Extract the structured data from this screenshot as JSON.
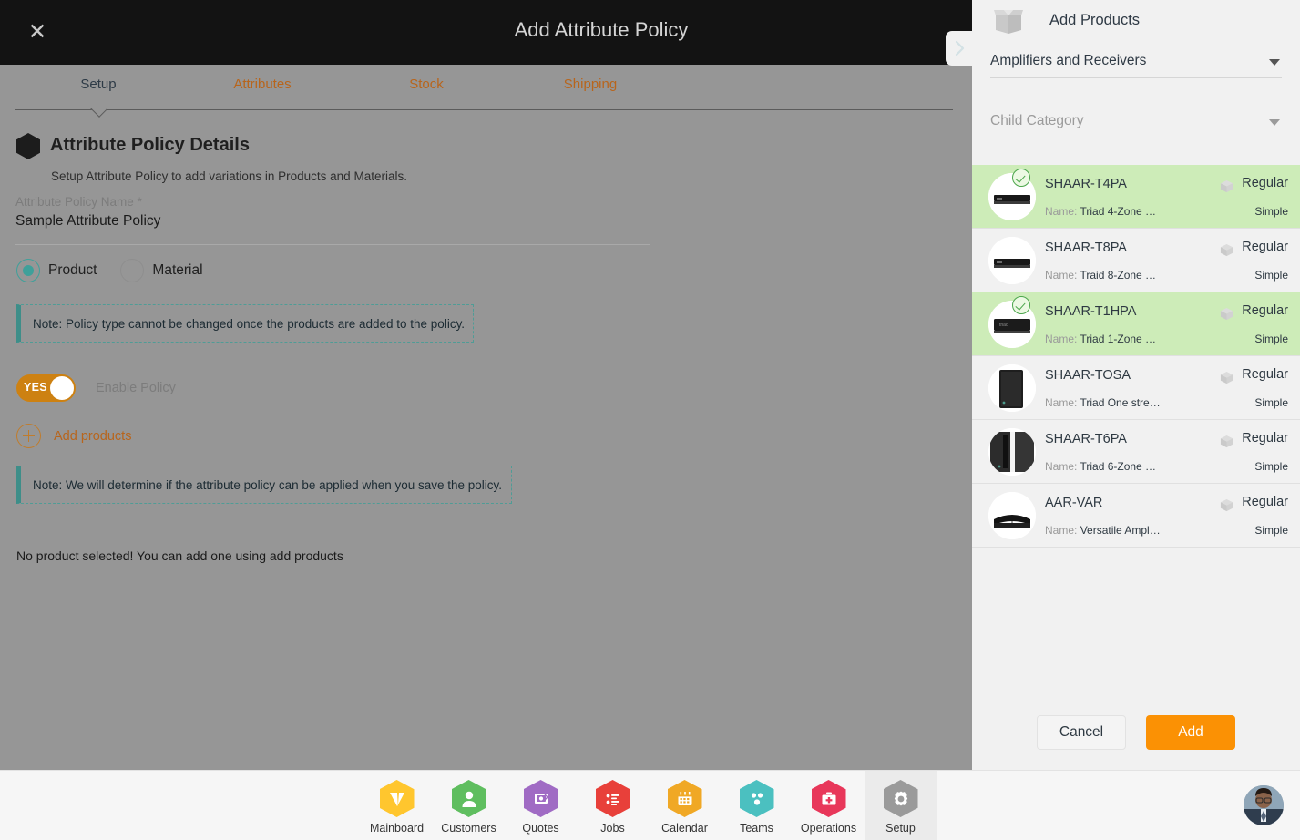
{
  "topbar": {
    "close_icon": "close-icon",
    "title": "Add Attribute Policy",
    "drawer_icon": "chevron-right-icon"
  },
  "tabs": [
    {
      "label": "Setup",
      "active": true
    },
    {
      "label": "Attributes",
      "active": false
    },
    {
      "label": "Stock",
      "active": false
    },
    {
      "label": "Shipping",
      "active": false
    }
  ],
  "form": {
    "section_icon": "hexagon-icon",
    "section_title": "Attribute Policy Details",
    "section_subtitle": "Setup Attribute Policy to add variations in Products and Materials.",
    "policy_name_label": "Attribute Policy Name *",
    "policy_name_value": "Sample Attribute Policy",
    "radio_product": "Product",
    "radio_material": "Material",
    "selected_type": "Product",
    "note_1": "Note: Policy type cannot be changed once the products are added to the policy.",
    "toggle_state": "YES",
    "toggle_label": "Enable Policy",
    "add_products_label": "Add products",
    "note_2": "Note: We will determine if the attribute policy can be applied when you save the policy.",
    "empty_message": "No product selected! You can add one using add products"
  },
  "panel": {
    "icon": "box-icon",
    "title": "Add Products",
    "parent_category_value": "Amplifiers and Receivers",
    "child_category_placeholder": "Child Category",
    "dropdown_icon": "chevron-down-icon",
    "name_key": "Name:",
    "cancel_label": "Cancel",
    "add_label": "Add",
    "products": [
      {
        "sku": "SHAAR-T4PA",
        "name": "Triad 4-Zone …",
        "type": "Regular",
        "variant": "Simple",
        "selected": true,
        "thumb": "amp-flat-black"
      },
      {
        "sku": "SHAAR-T8PA",
        "name": "Traid 8-Zone …",
        "type": "Regular",
        "variant": "Simple",
        "selected": false,
        "thumb": "amp-flat-black"
      },
      {
        "sku": "SHAAR-T1HPA",
        "name": "Triad 1-Zone …",
        "type": "Regular",
        "variant": "Simple",
        "selected": true,
        "thumb": "amp-box-black"
      },
      {
        "sku": "SHAAR-TOSA",
        "name": "Triad One stre…",
        "type": "Regular",
        "variant": "Simple",
        "selected": false,
        "thumb": "tower-black"
      },
      {
        "sku": "SHAAR-T6PA",
        "name": "Triad 6-Zone …",
        "type": "Regular",
        "variant": "Simple",
        "selected": false,
        "thumb": "rack-black"
      },
      {
        "sku": "AAR-VAR",
        "name": "Versatile Ampl…",
        "type": "Regular",
        "variant": "Simple",
        "selected": false,
        "thumb": "slab-black"
      }
    ]
  },
  "bottomnav": {
    "items": [
      {
        "label": "Mainboard",
        "icon": "mainboard-icon",
        "color": "#FFC62E",
        "active": false
      },
      {
        "label": "Customers",
        "icon": "customers-icon",
        "color": "#5FBE5F",
        "active": false
      },
      {
        "label": "Quotes",
        "icon": "quotes-icon",
        "color": "#A06BC4",
        "active": false
      },
      {
        "label": "Jobs",
        "icon": "jobs-icon",
        "color": "#E8403A",
        "active": false
      },
      {
        "label": "Calendar",
        "icon": "calendar-icon",
        "color": "#F0A825",
        "active": false
      },
      {
        "label": "Teams",
        "icon": "teams-icon",
        "color": "#4BC0C0",
        "active": false
      },
      {
        "label": "Operations",
        "icon": "operations-icon",
        "color": "#E8375A",
        "active": false
      },
      {
        "label": "Setup",
        "icon": "gear-icon",
        "color": "#9A9A9A",
        "active": true
      }
    ],
    "avatar": "user-avatar"
  },
  "colors": {
    "accent_orange": "#FB9104",
    "tab_inactive": "#B8651C",
    "toggle_on": "#CD8112",
    "radio_on": "#3FA09A",
    "note_border": "#3E8E89",
    "row_selected": "#CDECB8",
    "header_dark": "#131313",
    "dim_overlay": "#969696"
  }
}
